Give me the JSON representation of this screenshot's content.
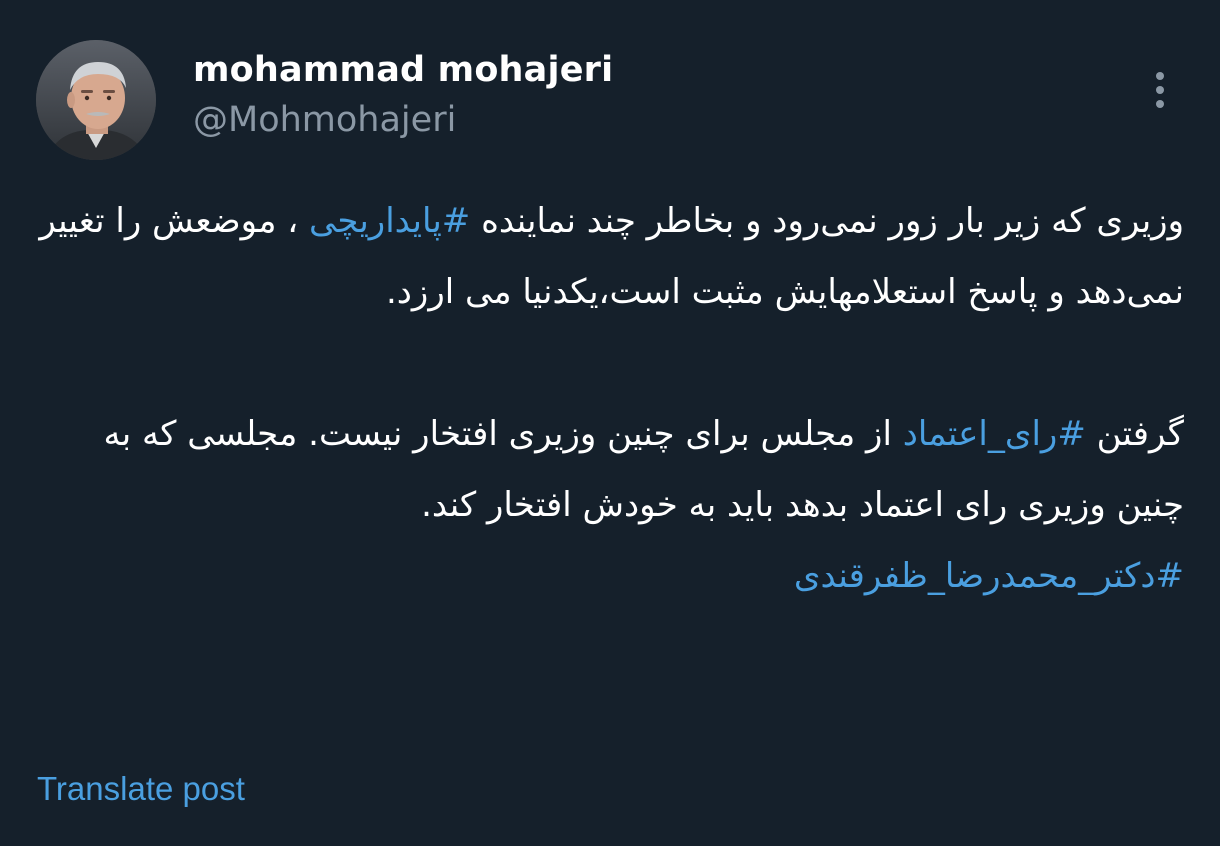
{
  "author": {
    "display_name": "mohammad mohajeri",
    "handle": "@Mohmohajeri",
    "avatar_icon": "profile-photo"
  },
  "tweet": {
    "para1_part1": "وزیری که زیر بار زور نمی‌رود و بخاطر چند نماینده ",
    "hashtag1": "#پایداریچی",
    "para1_part2": " ، موضعش را تغییر نمی‌دهد و پاسخ استعلامهایش مثبت است،یکدنیا می ارزد.",
    "para2_part1": "گرفتن ",
    "hashtag2": "#رای_اعتماد",
    "para2_part2": " از مجلس برای چنین وزیری افتخار نیست. مجلسی که به چنین وزیری رای اعتماد بدهد باید به خودش افتخار کند.",
    "hashtag3": "#دکتر_محمدرضا_ظفرقندی"
  },
  "actions": {
    "translate_label": "Translate post",
    "more_icon": "more-vertical-icon"
  },
  "colors": {
    "background": "#15202b",
    "text": "#ffffff",
    "secondary": "#8b98a5",
    "link": "#4a9fe0"
  }
}
